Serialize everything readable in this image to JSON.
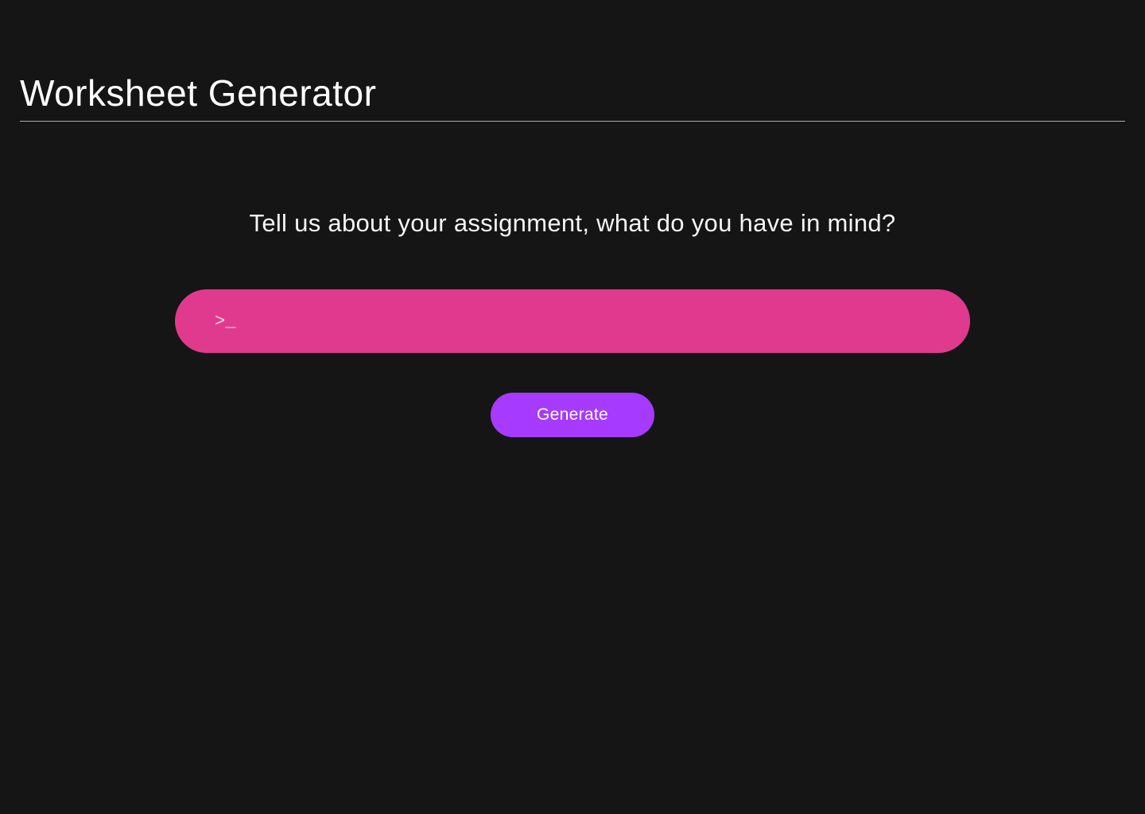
{
  "header": {
    "title": "Worksheet Generator"
  },
  "main": {
    "prompt": "Tell us about your assignment, what do you have in mind?",
    "input_placeholder": ">_",
    "input_value": "",
    "generate_label": "Generate"
  },
  "colors": {
    "background": "#151515",
    "input_bg": "#E03A8F",
    "button_bg": "#A63AFF",
    "text": "#ffffff"
  }
}
